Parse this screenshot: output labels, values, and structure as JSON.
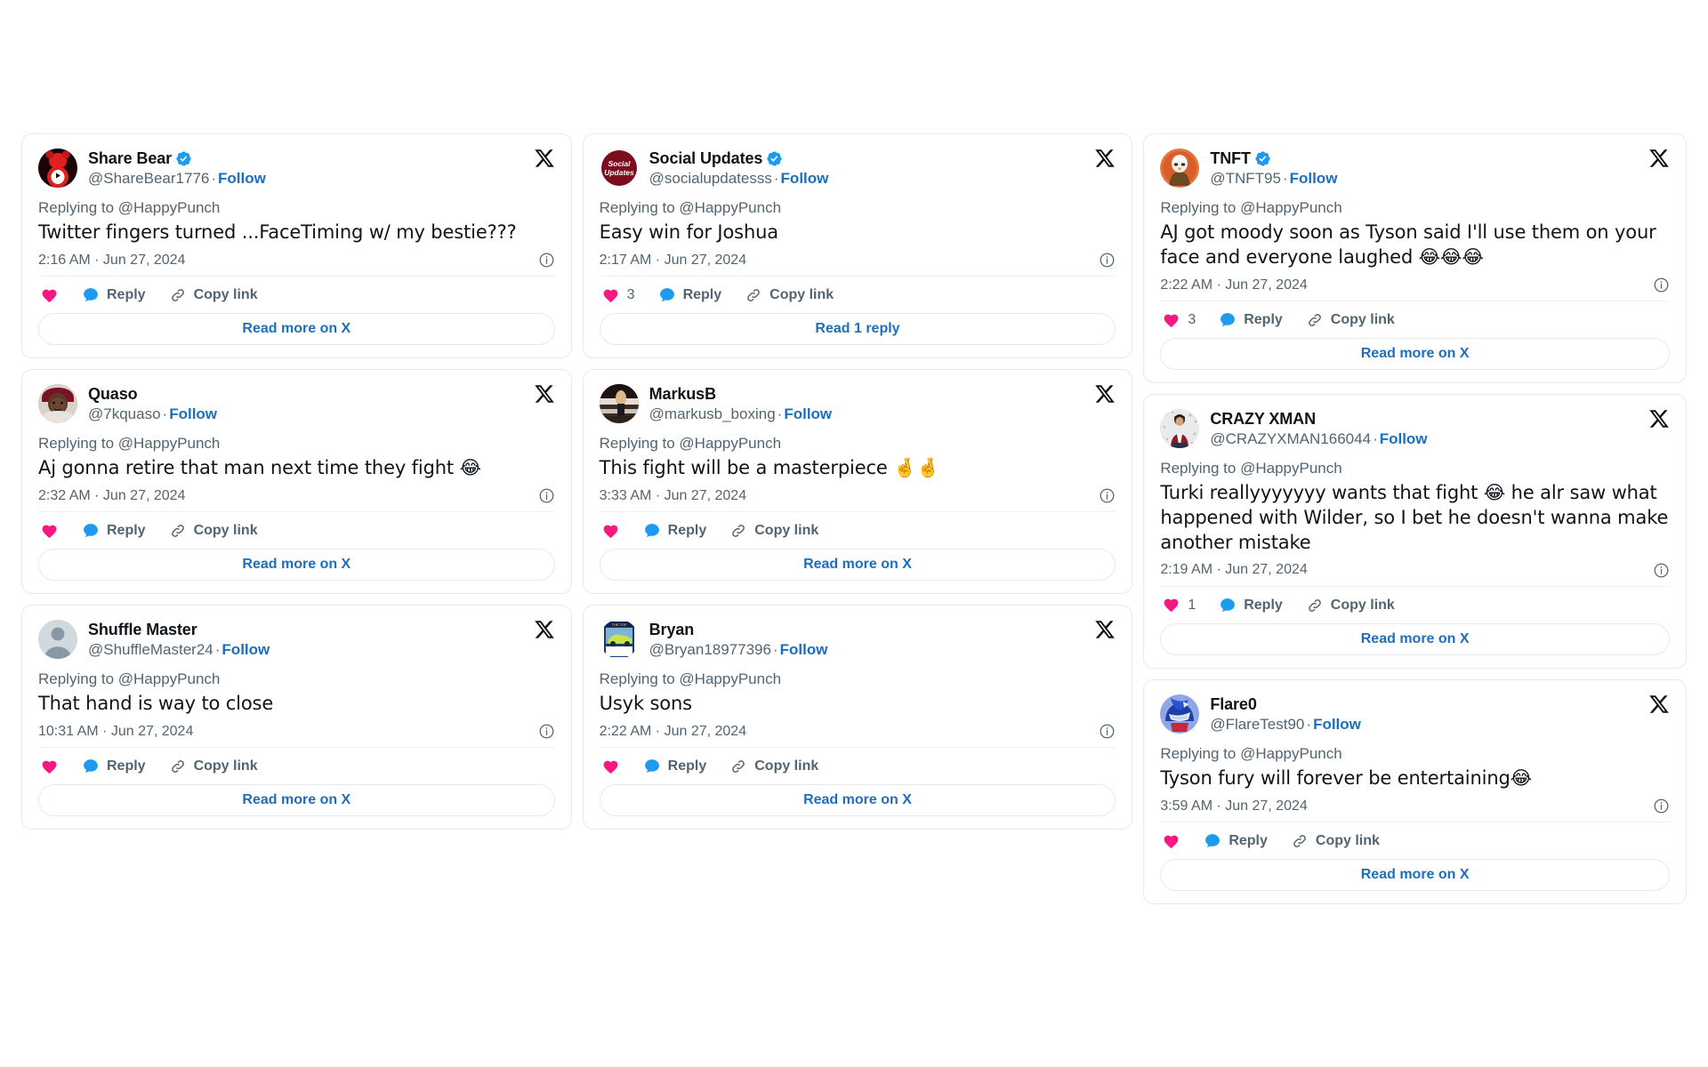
{
  "labels": {
    "replying_to": "Replying to @HappyPunch",
    "follow": "Follow",
    "reply": "Reply",
    "copy_link": "Copy link",
    "read_more": "Read more on X",
    "read_one_reply": "Read 1 reply",
    "separator": "·"
  },
  "colors": {
    "heart": "#f91880",
    "reply_bubble": "#1d9bf0",
    "link": "#1d6fbd",
    "verified": "#1d9bf0",
    "muted_text": "#536471",
    "primary_text": "#0f1419",
    "card_border": "#e6e9eb"
  },
  "columns": [
    {
      "cards": [
        {
          "name": "Share Bear",
          "handle": "@ShareBear1776",
          "verified": true,
          "avatar": "share-bear-avatar",
          "replying_to": "Replying to @HappyPunch",
          "text": "Twitter fingers turned ...FaceTiming w/ my bestie???",
          "timestamp": "2:16 AM · Jun 27, 2024",
          "like_count": "",
          "footer": "Read more on X"
        },
        {
          "name": "Quaso",
          "handle": "@7kquaso",
          "verified": false,
          "avatar": "quaso-avatar",
          "replying_to": "Replying to @HappyPunch",
          "text": "Aj gonna retire that man next time they fight 😂",
          "timestamp": "2:32 AM · Jun 27, 2024",
          "like_count": "",
          "footer": "Read more on X"
        },
        {
          "name": "Shuffle Master",
          "handle": "@ShuffleMaster24",
          "verified": false,
          "avatar": "default-avatar",
          "replying_to": "Replying to @HappyPunch",
          "text": "That hand is way to close",
          "timestamp": "10:31 AM · Jun 27, 2024",
          "like_count": "",
          "footer": "Read more on X"
        }
      ]
    },
    {
      "cards": [
        {
          "name": "Social Updates",
          "handle": "@socialupdatesss",
          "verified": true,
          "avatar": "social-updates-avatar",
          "replying_to": "Replying to @HappyPunch",
          "text": "Easy win for Joshua",
          "timestamp": "2:17 AM · Jun 27, 2024",
          "like_count": "3",
          "footer": "Read 1 reply"
        },
        {
          "name": "MarkusB",
          "handle": "@markusb_boxing",
          "verified": false,
          "avatar": "markusb-avatar",
          "replying_to": "Replying to @HappyPunch",
          "text": "This fight will be a masterpiece 🤞🤞",
          "timestamp": "3:33 AM · Jun 27, 2024",
          "like_count": "",
          "footer": "Read more on X"
        },
        {
          "name": "Bryan",
          "handle": "@Bryan18977396",
          "verified": false,
          "avatar": "bryan-avatar",
          "replying_to": "Replying to @HappyPunch",
          "text": "Usyk sons",
          "timestamp": "2:22 AM · Jun 27, 2024",
          "like_count": "",
          "footer": "Read more on X"
        }
      ]
    },
    {
      "cards": [
        {
          "name": "TNFT",
          "handle": "@TNFT95",
          "verified": true,
          "avatar": "tnft-avatar",
          "replying_to": "Replying to @HappyPunch",
          "text": "AJ got moody soon as Tyson said I'll use them on your face and everyone laughed 😂😂😂",
          "timestamp": "2:22 AM · Jun 27, 2024",
          "like_count": "3",
          "footer": "Read more on X"
        },
        {
          "name": "CRAZY XMAN",
          "handle": "@CRAZYXMAN166044",
          "verified": false,
          "avatar": "crazyxman-avatar",
          "replying_to": "Replying to @HappyPunch",
          "text": "Turki reallyyyyyyy wants that fight 😂 he alr saw what happened with Wilder, so I bet he doesn't wanna make another mistake",
          "timestamp": "2:19 AM · Jun 27, 2024",
          "like_count": "1",
          "footer": "Read more on X"
        },
        {
          "name": "Flare0",
          "handle": "@FlareTest90",
          "verified": false,
          "avatar": "flare0-avatar",
          "replying_to": "Replying to @HappyPunch",
          "text": "Tyson fury will forever be entertaining😂",
          "timestamp": "3:59 AM · Jun 27, 2024",
          "like_count": "",
          "footer": "Read more on X"
        }
      ]
    }
  ]
}
